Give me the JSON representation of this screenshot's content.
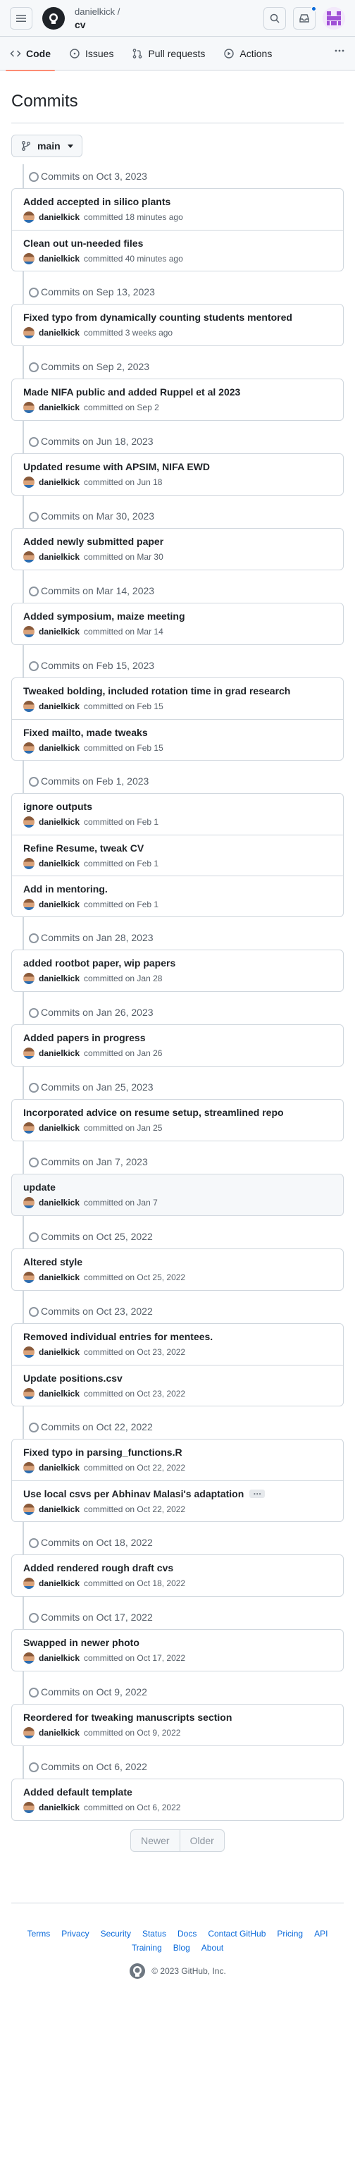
{
  "header": {
    "owner": "danielkick /",
    "repo": "cv"
  },
  "nav": {
    "tabs": [
      {
        "label": "Code",
        "icon": "code-icon",
        "active": true
      },
      {
        "label": "Issues",
        "icon": "issue-icon"
      },
      {
        "label": "Pull requests",
        "icon": "pull-request-icon"
      },
      {
        "label": "Actions",
        "icon": "play-icon"
      }
    ]
  },
  "page": {
    "title": "Commits",
    "branch": "main"
  },
  "groups": [
    {
      "header": "Commits on Oct 3, 2023",
      "commits": [
        {
          "msg": "Added accepted in silico plants",
          "author": "danielkick",
          "time": "committed 18 minutes ago"
        },
        {
          "msg": "Clean out un-needed files",
          "author": "danielkick",
          "time": "committed 40 minutes ago"
        }
      ]
    },
    {
      "header": "Commits on Sep 13, 2023",
      "commits": [
        {
          "msg": "Fixed typo from dynamically counting students mentored",
          "author": "danielkick",
          "time": "committed 3 weeks ago"
        }
      ]
    },
    {
      "header": "Commits on Sep 2, 2023",
      "commits": [
        {
          "msg": "Made NIFA public and added Ruppel et al 2023",
          "author": "danielkick",
          "time": "committed on Sep 2"
        }
      ]
    },
    {
      "header": "Commits on Jun 18, 2023",
      "commits": [
        {
          "msg": "Updated resume with APSIM, NIFA EWD",
          "author": "danielkick",
          "time": "committed on Jun 18"
        }
      ]
    },
    {
      "header": "Commits on Mar 30, 2023",
      "commits": [
        {
          "msg": "Added newly submitted paper",
          "author": "danielkick",
          "time": "committed on Mar 30"
        }
      ]
    },
    {
      "header": "Commits on Mar 14, 2023",
      "commits": [
        {
          "msg": "Added symposium, maize meeting",
          "author": "danielkick",
          "time": "committed on Mar 14"
        }
      ]
    },
    {
      "header": "Commits on Feb 15, 2023",
      "commits": [
        {
          "msg": "Tweaked bolding, included rotation time in grad research",
          "author": "danielkick",
          "time": "committed on Feb 15"
        },
        {
          "msg": "Fixed mailto, made tweaks",
          "author": "danielkick",
          "time": "committed on Feb 15"
        }
      ]
    },
    {
      "header": "Commits on Feb 1, 2023",
      "commits": [
        {
          "msg": "ignore outputs",
          "author": "danielkick",
          "time": "committed on Feb 1"
        },
        {
          "msg": "Refine Resume, tweak CV",
          "author": "danielkick",
          "time": "committed on Feb 1"
        },
        {
          "msg": "Add in mentoring.",
          "author": "danielkick",
          "time": "committed on Feb 1"
        }
      ]
    },
    {
      "header": "Commits on Jan 28, 2023",
      "commits": [
        {
          "msg": "added rootbot paper, wip papers",
          "author": "danielkick",
          "time": "committed on Jan 28"
        }
      ]
    },
    {
      "header": "Commits on Jan 26, 2023",
      "commits": [
        {
          "msg": "Added papers in progress",
          "author": "danielkick",
          "time": "committed on Jan 26"
        }
      ]
    },
    {
      "header": "Commits on Jan 25, 2023",
      "commits": [
        {
          "msg": "Incorporated advice on resume setup, streamlined repo",
          "author": "danielkick",
          "time": "committed on Jan 25"
        }
      ]
    },
    {
      "header": "Commits on Jan 7, 2023",
      "highlight": true,
      "commits": [
        {
          "msg": "update",
          "author": "danielkick",
          "time": "committed on Jan 7"
        }
      ]
    },
    {
      "header": "Commits on Oct 25, 2022",
      "commits": [
        {
          "msg": "Altered style",
          "author": "danielkick",
          "time": "committed on Oct 25, 2022"
        }
      ]
    },
    {
      "header": "Commits on Oct 23, 2022",
      "commits": [
        {
          "msg": "Removed individual entries for mentees.",
          "author": "danielkick",
          "time": "committed on Oct 23, 2022"
        },
        {
          "msg": "Update positions.csv",
          "author": "danielkick",
          "time": "committed on Oct 23, 2022"
        }
      ]
    },
    {
      "header": "Commits on Oct 22, 2022",
      "commits": [
        {
          "msg": "Fixed typo in parsing_functions.R",
          "author": "danielkick",
          "time": "committed on Oct 22, 2022"
        },
        {
          "msg": "Use local csvs per Abhinav Malasi's adaptation",
          "author": "danielkick",
          "time": "committed on Oct 22, 2022",
          "ellipsis": "…"
        }
      ]
    },
    {
      "header": "Commits on Oct 18, 2022",
      "commits": [
        {
          "msg": "Added rendered rough draft cvs",
          "author": "danielkick",
          "time": "committed on Oct 18, 2022"
        }
      ]
    },
    {
      "header": "Commits on Oct 17, 2022",
      "commits": [
        {
          "msg": "Swapped in newer photo",
          "author": "danielkick",
          "time": "committed on Oct 17, 2022"
        }
      ]
    },
    {
      "header": "Commits on Oct 9, 2022",
      "commits": [
        {
          "msg": "Reordered for tweaking manuscripts section",
          "author": "danielkick",
          "time": "committed on Oct 9, 2022"
        }
      ]
    },
    {
      "header": "Commits on Oct 6, 2022",
      "commits": [
        {
          "msg": "Added default template",
          "author": "danielkick",
          "time": "committed on Oct 6, 2022"
        }
      ]
    }
  ],
  "pagination": {
    "newer": "Newer",
    "older": "Older"
  },
  "footer": {
    "links": [
      "Terms",
      "Privacy",
      "Security",
      "Status",
      "Docs",
      "Contact GitHub",
      "Pricing",
      "API",
      "Training",
      "Blog",
      "About"
    ],
    "copyright": "© 2023 GitHub, Inc."
  },
  "colors": {
    "accent": "#0969da",
    "active_tab": "#fd8c73",
    "border": "#d0d7de"
  }
}
